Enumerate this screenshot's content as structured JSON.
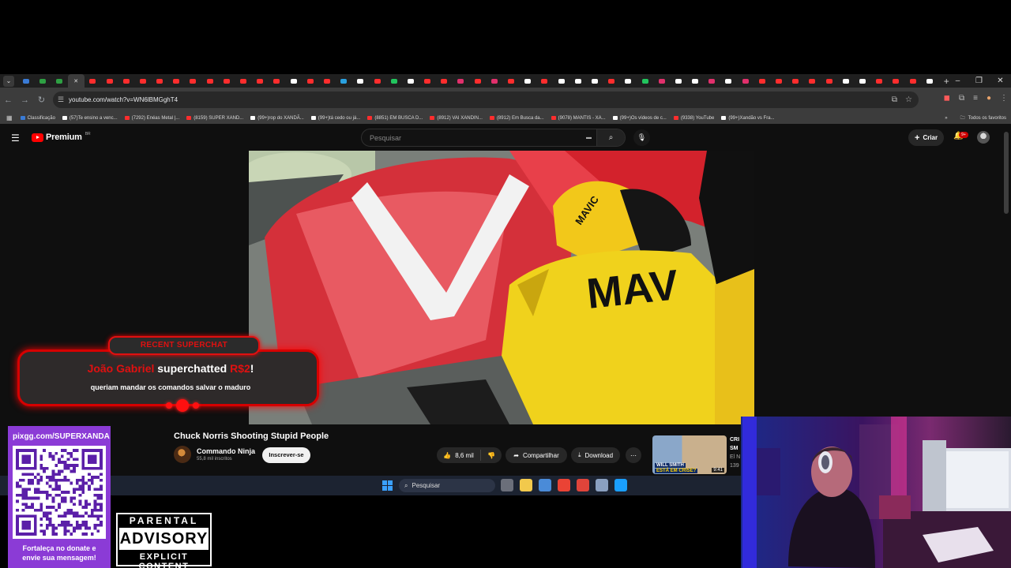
{
  "browser": {
    "tab_favicons": [
      "#3a7bd5",
      "#2ea043",
      "#2ea043",
      "#e8e8e8",
      "#ff2d2d",
      "#ff2d2d",
      "#ff2d2d",
      "#ff2d2d",
      "#ff2d2d",
      "#ff2d2d",
      "#ff2d2d",
      "#ff2d2d",
      "#ff2d2d",
      "#ff2d2d",
      "#ff2d2d",
      "#ff2d2d",
      "#ffffff",
      "#ff2d2d",
      "#ff2d2d",
      "#2aa1e0",
      "#ffffff",
      "#ff2d2d",
      "#22c55e",
      "#ffffff",
      "#ff2d2d",
      "#ff2d2d",
      "#e1306c",
      "#ff2d2d",
      "#e1306c",
      "#ff2d2d",
      "#ffffff",
      "#ff2d2d",
      "#ffffff",
      "#ffffff",
      "#ffffff",
      "#ff2d2d",
      "#ffffff",
      "#22c55e",
      "#e1306c",
      "#ffffff",
      "#ffffff",
      "#e1306c",
      "#ffffff",
      "#e1306c",
      "#ff2d2d",
      "#ff2d2d",
      "#ff2d2d",
      "#ff2d2d",
      "#ff2d2d",
      "#ffffff",
      "#ffffff",
      "#ff2d2d",
      "#ff2d2d",
      "#ff2d2d",
      "#ffffff"
    ],
    "active_tab_icon": "close-icon",
    "new_tab_label": "+",
    "url": "youtube.com/watch?v=WN6lBMGghT4",
    "bookmarks": [
      {
        "label": "Classificação",
        "color": "#3a7bd5"
      },
      {
        "label": "(57)Te ensino a venc...",
        "color": "#ffffff"
      },
      {
        "label": "(7292) Enéas Metal |...",
        "color": "#ff2d2d"
      },
      {
        "label": "(8159) SUPER XAND...",
        "color": "#ff2d2d"
      },
      {
        "label": "(99+)rop do XANDÃ...",
        "color": "#ffffff"
      },
      {
        "label": "(99+)tá cedo ou já...",
        "color": "#ffffff"
      },
      {
        "label": "(8851) EM BUSCA D...",
        "color": "#ff2d2d"
      },
      {
        "label": "(8912) VAI XANDIN...",
        "color": "#ff2d2d"
      },
      {
        "label": "(8912) Em Busca da...",
        "color": "#ff2d2d"
      },
      {
        "label": "(9078) MANTIS - XA...",
        "color": "#ff2d2d"
      },
      {
        "label": "(99+)Os vídeos de c...",
        "color": "#ffffff"
      },
      {
        "label": "(9338) YouTube",
        "color": "#ff2d2d"
      },
      {
        "label": "(99+)Xandão vs Fra...",
        "color": "#ffffff"
      }
    ],
    "all_bookmarks": "Todos os favoritos"
  },
  "youtube": {
    "logo": "Premium",
    "region": "BR",
    "search_placeholder": "Pesquisar",
    "create_label": "Criar",
    "notif_count": "9+",
    "video_title": "Chuck Norris Shooting Stupid People",
    "channel_name": "Commando Ninja",
    "channel_subs": "55,8 mil inscritos",
    "subscribe_label": "Inscrever-se",
    "like_count": "8,6 mil",
    "share_label": "Compartilhar",
    "download_label": "Download",
    "rec": {
      "caption1": "WILL SMITH",
      "caption2": "ESTÁ EM CRISE?",
      "duration": "9:41",
      "title_line1": "CRI",
      "title_line2": "SM",
      "channel": "El N",
      "views": "139"
    }
  },
  "overlay": {
    "recent_tag": "RECENT SUPERCHAT",
    "donor": "João Gabriel",
    "action": "superchatted",
    "amount": "R$2",
    "bang": "!",
    "message": "queriam mandar os comandos salvar o maduro"
  },
  "taskbar": {
    "search_label": "Pesquisar",
    "app_colors": [
      "#6b6f7a",
      "#f2c94c",
      "#4a8bd8",
      "#ea4335",
      "#e0443a",
      "#8aa0c0",
      "#1a9fff"
    ]
  },
  "qr": {
    "url": "pixgg.com/SUPERXANDA",
    "message_line1": "Fortaleça no donate e",
    "message_line2": "envie sua mensagem!"
  },
  "advisory": {
    "top": "PARENTAL",
    "middle": "ADVISORY",
    "bottom": "EXPLICIT CONTENT"
  }
}
